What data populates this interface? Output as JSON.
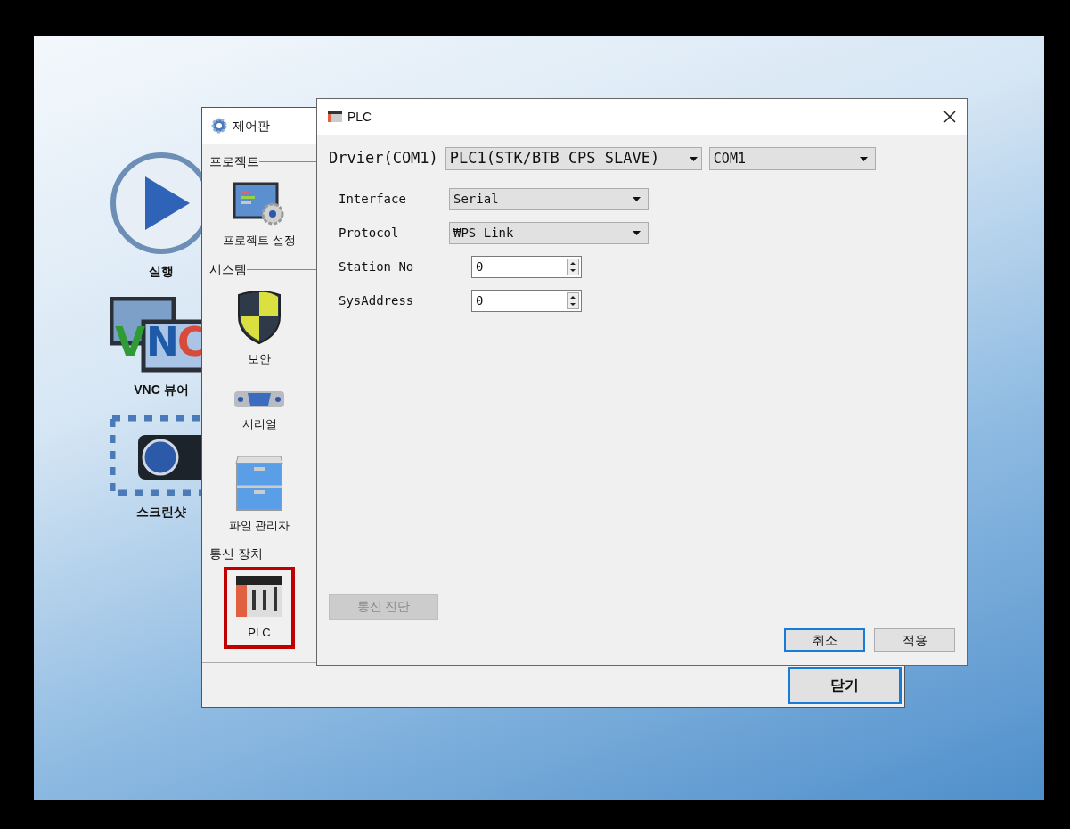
{
  "desktop_icons": [
    {
      "label": "실행",
      "kind": "play"
    },
    {
      "label": "VNC 뷰어",
      "kind": "vnc",
      "logo_letters": [
        "V",
        "N",
        "C"
      ]
    },
    {
      "label": "스크린샷",
      "kind": "camera"
    }
  ],
  "control_panel": {
    "title": "제어판",
    "sections": [
      {
        "heading": "프로젝트",
        "items": [
          {
            "label": "프로젝트 설정",
            "kind": "project",
            "selected": false
          }
        ]
      },
      {
        "heading": "시스템",
        "items": [
          {
            "label": "보안",
            "kind": "shield",
            "selected": false
          },
          {
            "label": "시리얼",
            "kind": "serial",
            "selected": false
          },
          {
            "label": "파일 관리자",
            "kind": "cabinet",
            "selected": false
          }
        ]
      },
      {
        "heading": "통신 장치",
        "items": [
          {
            "label": "PLC",
            "kind": "plc",
            "selected": true
          }
        ]
      }
    ],
    "close_button": {
      "label": "닫기",
      "focused": true
    }
  },
  "plc_dialog": {
    "title": "PLC",
    "driver_label": "Drvier(COM1)",
    "driver_select": "PLC1(STK/BTB CPS SLAVE)",
    "port_select": "COM1",
    "fields": [
      {
        "label": "Interface",
        "kind": "select",
        "value": "Serial"
      },
      {
        "label": "Protocol",
        "kind": "select",
        "value": "₩PS Link"
      },
      {
        "label": "Station No",
        "kind": "spin",
        "value": "0"
      },
      {
        "label": "SysAddress",
        "kind": "spin",
        "value": "0"
      }
    ],
    "diagnose_button": {
      "label": "통신 진단",
      "disabled": true
    },
    "buttons": [
      {
        "label": "취소",
        "focused": true
      },
      {
        "label": "적용",
        "focused": false
      }
    ]
  }
}
